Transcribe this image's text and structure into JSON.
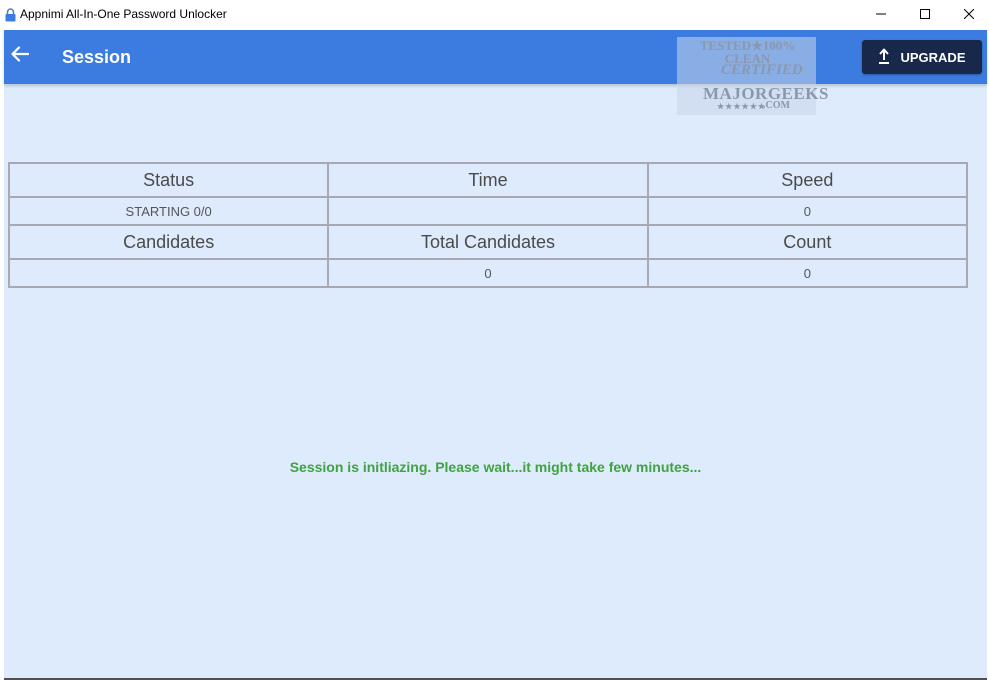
{
  "window": {
    "title": "Appnimi All-In-One Password Unlocker",
    "icon": "lock-icon",
    "controls": [
      "minimize-icon",
      "maximize-icon",
      "close-icon"
    ]
  },
  "appbar": {
    "title": "Session",
    "back_icon": "arrow-left-icon",
    "upgrade_label": "UPGRADE",
    "upgrade_icon": "upload-arrow-icon",
    "color": "#3c7ce0"
  },
  "watermark": {
    "line1": "TESTED★100% CLEAN",
    "line2": "CERTIFIED",
    "line3": "MAJORGEEKS",
    "line4": ".COM",
    "stars": "★★★★★★"
  },
  "table": {
    "row1_headers": [
      "Status",
      "Time",
      "Speed"
    ],
    "row1_values": [
      "STARTING 0/0",
      "",
      "0"
    ],
    "row2_headers": [
      "Candidates",
      "Total Candidates",
      "Count"
    ],
    "row2_values": [
      "",
      "0",
      "0"
    ]
  },
  "status_message": "Session is initliazing. Please wait...it might take few minutes...",
  "colors": {
    "background": "#deebfc",
    "message": "#3fa33f",
    "upgrade_button": "#17284a"
  }
}
